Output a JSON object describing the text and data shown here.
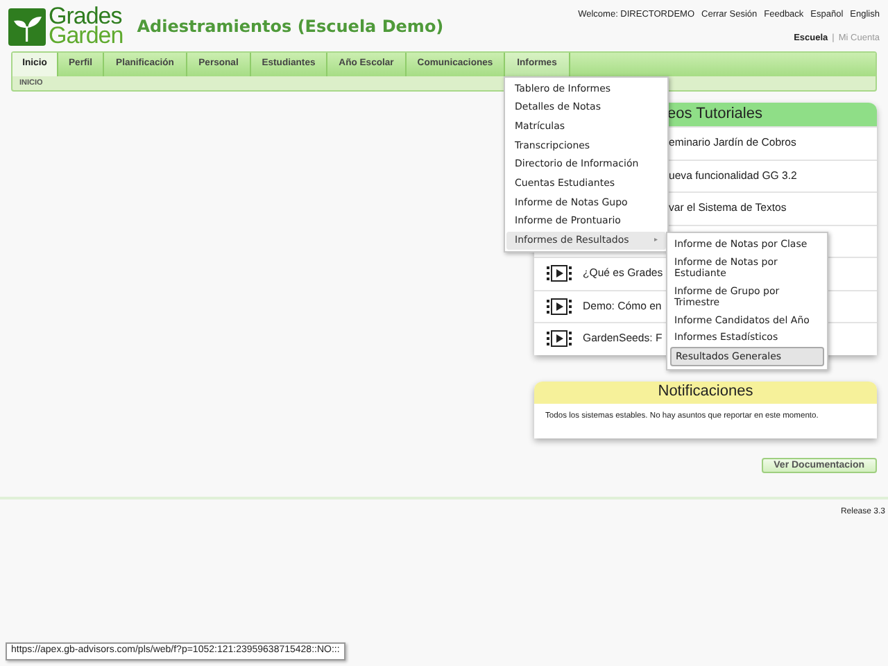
{
  "logo": {
    "line1": "Grades",
    "line2": "Garden"
  },
  "title": "Adiestramientos (Escuela Demo)",
  "top_links": [
    "Welcome: DIRECTORDEMO",
    "Cerrar Sesión",
    "Feedback",
    "Español",
    "English"
  ],
  "account_separator": "|",
  "account_links": [
    {
      "label": "Escuela",
      "selected": true
    },
    {
      "label": "Mi Cuenta",
      "selected": false
    }
  ],
  "tabs": [
    {
      "label": "Inicio",
      "selected": true,
      "open": false
    },
    {
      "label": "Perfil",
      "selected": false,
      "open": false
    },
    {
      "label": "Planificación",
      "selected": false,
      "open": false
    },
    {
      "label": "Personal",
      "selected": false,
      "open": false
    },
    {
      "label": "Estudiantes",
      "selected": false,
      "open": false
    },
    {
      "label": "Año Escolar",
      "selected": false,
      "open": false
    },
    {
      "label": "Comunicaciones",
      "selected": false,
      "open": false
    },
    {
      "label": "Informes",
      "selected": false,
      "open": true
    }
  ],
  "breadcrumb": "INICIO",
  "tutorials": {
    "title": "eos Tutoriales",
    "rows": [
      {
        "kind": "covered",
        "title": "eminario Jardín de Cobros"
      },
      {
        "kind": "covered",
        "title": "ueva funcionalidad GG 3.2"
      },
      {
        "kind": "covered",
        "title": "var el Sistema de Textos"
      },
      {
        "kind": "hidden"
      },
      {
        "kind": "video",
        "title": "¿Qué es Grades"
      },
      {
        "kind": "video",
        "title": "Demo: Cómo en"
      },
      {
        "kind": "video",
        "title": "GardenSeeds: F"
      }
    ]
  },
  "notifications": {
    "title": "Notificaciones",
    "text": "Todos los sistemas estables. No hay asuntos que reportar en este momento."
  },
  "doc_button": "Ver Documentacion",
  "release": "Release 3.3",
  "menu": [
    {
      "label": "Tablero de Informes",
      "selected": false
    },
    {
      "label": "Detalles de Notas",
      "selected": false
    },
    {
      "label": "Matrículas",
      "selected": false
    },
    {
      "label": "Transcripciones",
      "selected": false
    },
    {
      "label": "Directorio de Información",
      "selected": false
    },
    {
      "label": "Cuentas Estudiantes",
      "selected": false
    },
    {
      "label": "Informe de Notas Gupo",
      "selected": false
    },
    {
      "label": "Informe de Prontuario",
      "selected": false
    },
    {
      "label": "Informes de Resultados",
      "selected": true,
      "arrow": "▸"
    }
  ],
  "submenu": [
    {
      "label": "Informe de Notas por Clase",
      "selected": false
    },
    {
      "label": "Informe de Notas por Estudiante",
      "selected": false
    },
    {
      "label": "Informe de Grupo por Trimestre",
      "selected": false
    },
    {
      "label": "Informe Candidatos del Año",
      "selected": false
    },
    {
      "label": "Informes Estadísticos",
      "selected": false
    },
    {
      "label": "Resultados Generales",
      "selected": true
    }
  ],
  "status_url": "https://apex.gb-advisors.com/pls/web/f?p=1052:121:23959638715428::NO:::"
}
